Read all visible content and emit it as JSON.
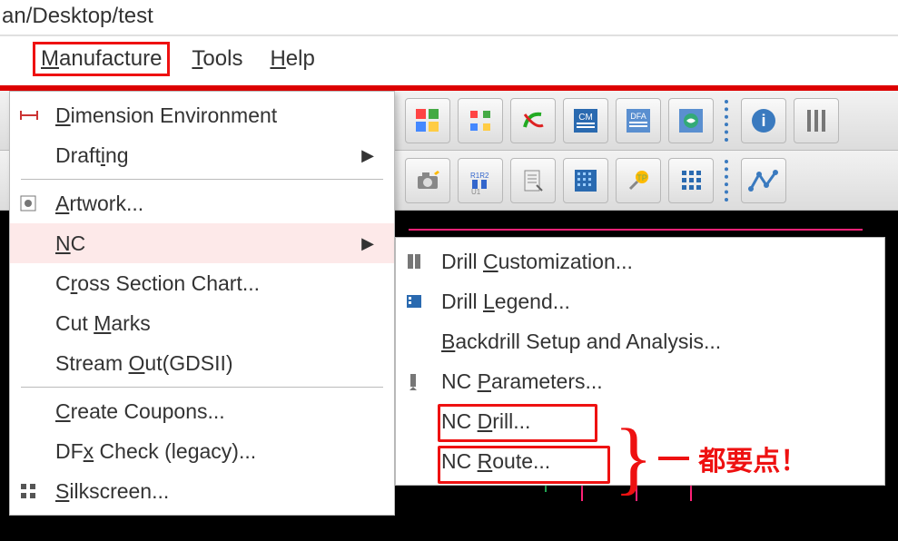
{
  "title_path": "an/Desktop/test",
  "menubar": {
    "manufacture": "Manufacture",
    "tools": "Tools",
    "help": "Help"
  },
  "menu_main": {
    "dimension_env": "Dimension Environment",
    "drafting": "Drafting",
    "artwork": "Artwork...",
    "nc": "NC",
    "cross_section": "Cross Section Chart...",
    "cut_marks": "Cut Marks",
    "stream_out": "Stream Out(GDSII)",
    "create_coupons": "Create Coupons...",
    "dfx_check": "DFx Check (legacy)...",
    "silkscreen": "Silkscreen..."
  },
  "menu_sub": {
    "drill_custom": "Drill Customization...",
    "drill_legend": "Drill Legend...",
    "backdrill": "Backdrill Setup and Analysis...",
    "nc_params": "NC Parameters...",
    "nc_drill": "NC Drill...",
    "nc_route": "NC Route..."
  },
  "annotation": "都要点！",
  "icons": {
    "dim": "dimension-icon",
    "artwork": "artwork-icon",
    "silkscreen": "silkscreen-icon",
    "drill_custom": "drill-custom-icon",
    "drill_legend": "drill-legend-icon",
    "nc_params": "nc-params-icon"
  },
  "colors": {
    "accent_red": "#e11",
    "menu_hover": "#fde9e9"
  }
}
